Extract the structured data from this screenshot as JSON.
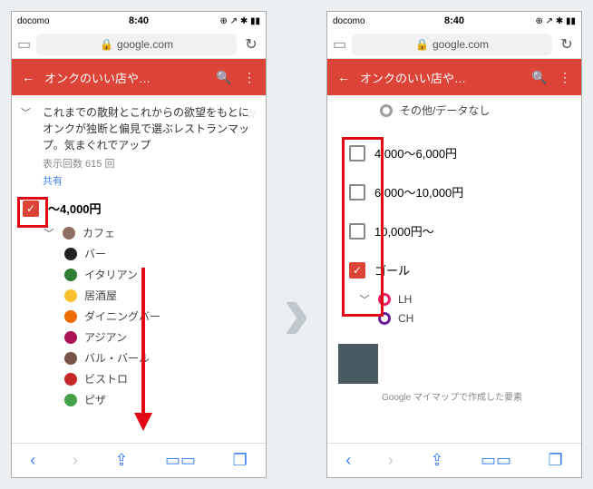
{
  "status": {
    "carrier": "docomo",
    "time": "8:40"
  },
  "url": {
    "domain": "google.com"
  },
  "appbar": {
    "title": "オンクのいい店や…"
  },
  "left": {
    "desc": "これまでの散財とこれからの欲望をもとにオンクが独断と偏見で選ぶレストランマップ。気まぐれでアップ",
    "views": "表示回数 615 回",
    "share": "共有",
    "section": "～4,000円",
    "cats": [
      "カフェ",
      "バー",
      "イタリアン",
      "居酒屋",
      "ダイニングバー",
      "アジアン",
      "バル・バール",
      "ビストロ",
      "ピザ"
    ]
  },
  "right": {
    "top_label": "その他/データなし",
    "opts": [
      "4,000～6,000円",
      "6,000～10,000円",
      "10,000円～",
      "ゴール"
    ],
    "sub": [
      "LH",
      "CH"
    ],
    "footer": "Google マイマップで作成した要素"
  },
  "cat_colors": [
    "#8d6e63",
    "#212121",
    "#2e7d32",
    "#fbc02d",
    "#ef6c00",
    "#ad1457",
    "#795548",
    "#c62828",
    "#43a047"
  ],
  "ring_colors": {
    "grey": "#9e9e9e",
    "lh": "#e91e63",
    "ch": "#6a1b9a"
  }
}
